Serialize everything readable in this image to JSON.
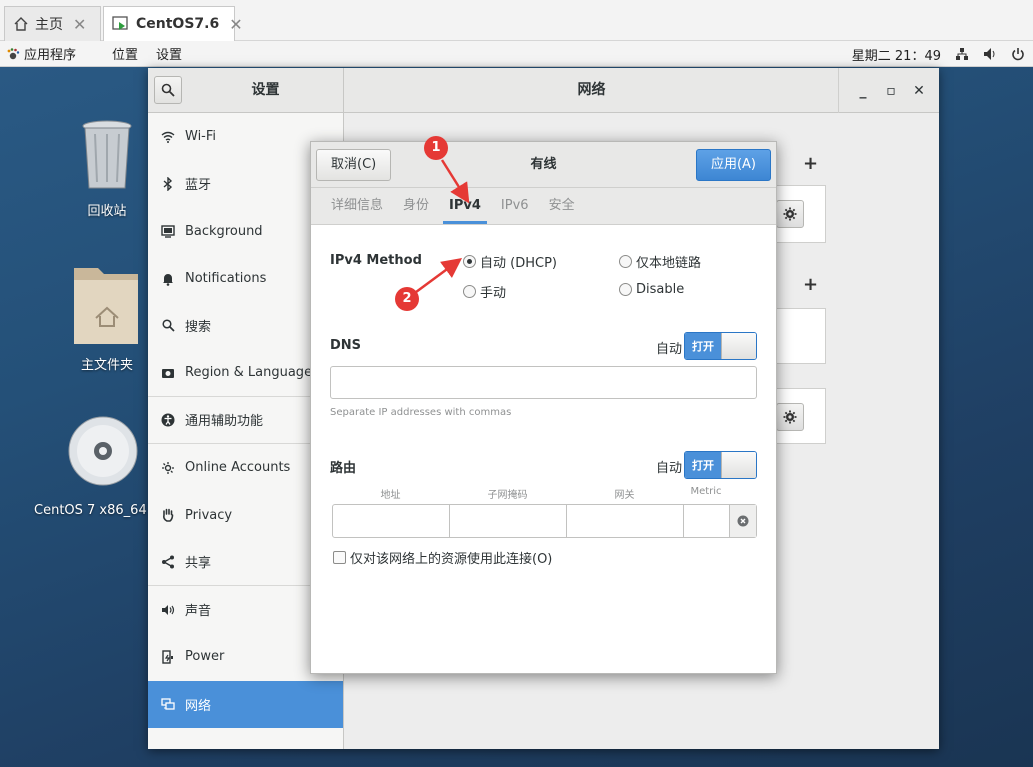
{
  "vm_tabs": [
    {
      "label": "主页",
      "active": false
    },
    {
      "label": "CentOS7.6",
      "active": true
    }
  ],
  "topbar": {
    "apps": "应用程序",
    "places": "位置",
    "settings": "设置",
    "clock": "星期二 21：49"
  },
  "desktop": {
    "trash": "回收站",
    "home": "主文件夹",
    "disc": "CentOS 7 x86_64"
  },
  "settings": {
    "left_title": "设置",
    "right_title": "网络",
    "sidebar": [
      {
        "label": "Wi-Fi",
        "icon": "wifi-icon"
      },
      {
        "label": "蓝牙",
        "icon": "bluetooth-icon"
      },
      {
        "label": "Background",
        "icon": "background-icon"
      },
      {
        "label": "Notifications",
        "icon": "bell-icon"
      },
      {
        "label": "搜索",
        "icon": "search-icon"
      },
      {
        "label": "Region & Language",
        "icon": "camera-icon"
      },
      {
        "label": "通用辅助功能",
        "icon": "accessibility-icon"
      },
      {
        "label": "Online Accounts",
        "icon": "online-accounts-icon"
      },
      {
        "label": "Privacy",
        "icon": "hand-icon"
      },
      {
        "label": "共享",
        "icon": "share-icon"
      },
      {
        "label": "声音",
        "icon": "speaker-icon"
      },
      {
        "label": "Power",
        "icon": "power-icon"
      },
      {
        "label": "网络",
        "icon": "network-icon"
      }
    ]
  },
  "dialog": {
    "cancel": "取消(C)",
    "title": "有线",
    "apply": "应用(A)",
    "tabs": [
      "详细信息",
      "身份",
      "IPv4",
      "IPv6",
      "安全"
    ],
    "active_tab": "IPv4",
    "ipv4_method_label": "IPv4 Method",
    "methods": [
      "自动 (DHCP)",
      "仅本地链路",
      "手动",
      "Disable"
    ],
    "selected_method": "自动 (DHCP)",
    "dns_label": "DNS",
    "auto_label": "自动",
    "switch_on": "打开",
    "dns_value": "",
    "dns_hint": "Separate IP addresses with commas",
    "routes_label": "路由",
    "route_columns": [
      "地址",
      "子网掩码",
      "网关",
      "Metric"
    ],
    "only_local_checkbox": "仅对该网络上的资源使用此连接(O)"
  },
  "annotations": [
    "1",
    "2"
  ],
  "colors": {
    "accent": "#4a90d9",
    "badge": "#e53935"
  }
}
